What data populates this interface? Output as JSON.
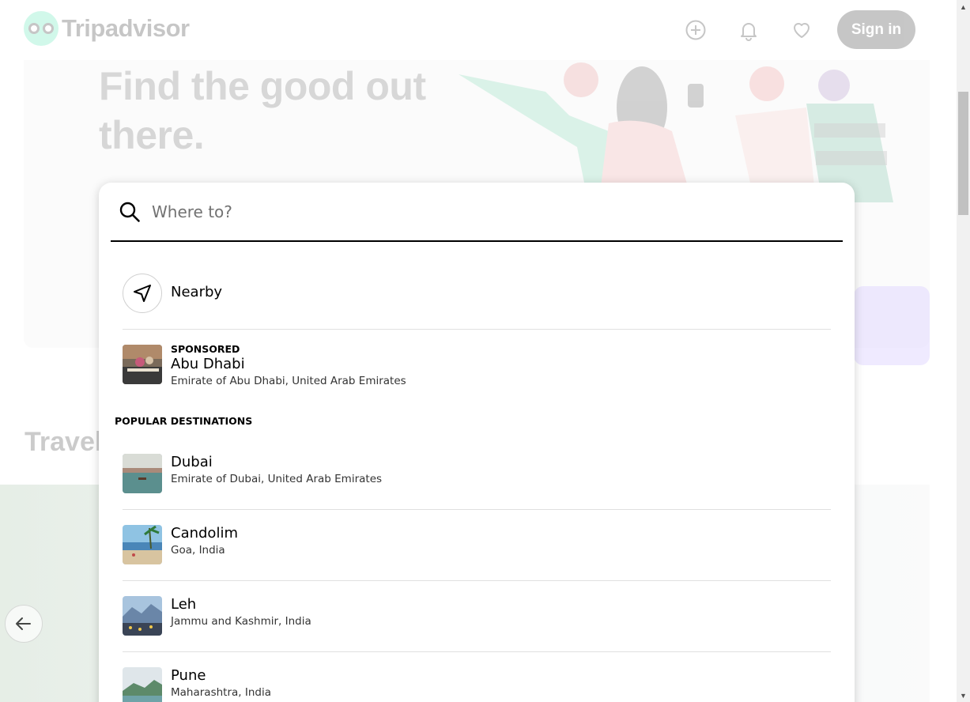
{
  "header": {
    "logo_text": "Tripadvisor",
    "sign_in_label": "Sign in",
    "icons": [
      "plus-circle-icon",
      "bell-icon",
      "heart-icon"
    ]
  },
  "hero": {
    "title": "Find the good out there."
  },
  "section_title": "Travel",
  "search": {
    "placeholder": "Where to?",
    "value": ""
  },
  "dropdown": {
    "nearby_label": "Nearby",
    "sponsored_label": "SPONSORED",
    "sponsored": {
      "name": "Abu Dhabi",
      "location": "Emirate of Abu Dhabi, United Arab Emirates"
    },
    "popular_label": "POPULAR DESTINATIONS",
    "destinations": [
      {
        "name": "Dubai",
        "location": "Emirate of Dubai, United Arab Emirates"
      },
      {
        "name": "Candolim",
        "location": "Goa, India"
      },
      {
        "name": "Leh",
        "location": "Jammu and Kashmir, India"
      },
      {
        "name": "Pune",
        "location": "Maharashtra, India"
      }
    ]
  },
  "colors": {
    "brand_green": "#34e0a1",
    "divider": "#e0e0e0",
    "text_secondary": "#333333"
  }
}
